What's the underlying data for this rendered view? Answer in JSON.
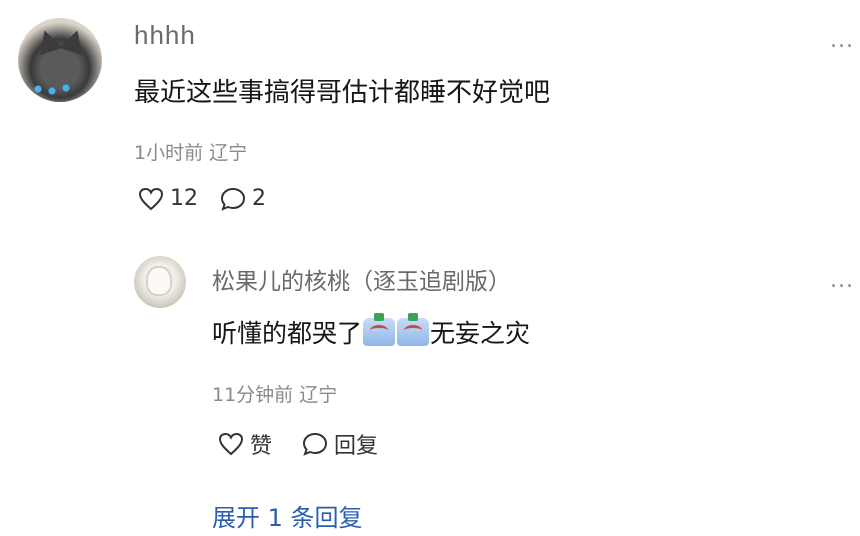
{
  "comment": {
    "username": "hhhh",
    "text": "最近这些事搞得哥估计都睡不好觉吧",
    "time": "1小时前",
    "location": "辽宁",
    "likes": "12",
    "replies": "2",
    "more": "..."
  },
  "reply": {
    "username": "松果儿的核桃（逐玉追剧版）",
    "text_before": "听懂的都哭了",
    "text_after": "无妄之灾",
    "emojis": [
      "emoji",
      "emoji"
    ],
    "time": "11分钟前",
    "location": "辽宁",
    "like_label": "赞",
    "reply_label": "回复",
    "more": "..."
  },
  "expand": {
    "label": "展开 1 条回复"
  },
  "colors": {
    "link": "#2a5db0",
    "meta": "#8a8a8a",
    "username": "#6a6a6a"
  },
  "icons": [
    "heart-icon",
    "comment-bubble-icon",
    "more-icon"
  ]
}
